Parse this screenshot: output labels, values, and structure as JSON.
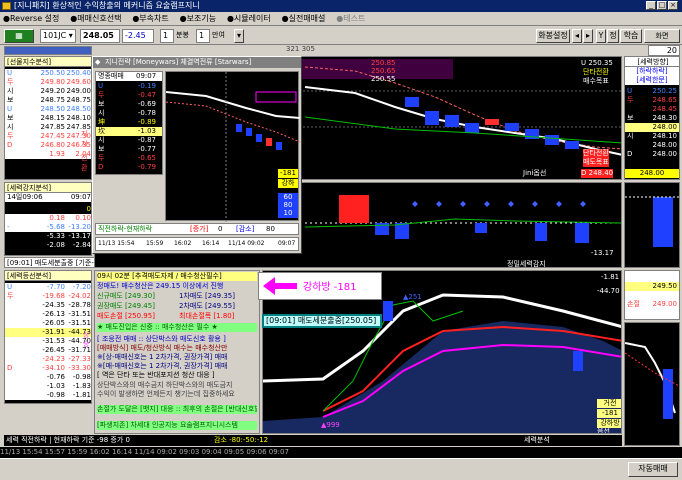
{
  "window": {
    "title": "[지니패치] 환상적인 수익창출의 메커니즘 요술램프지니"
  },
  "menu": [
    "Reverse 설정",
    "매매신호선택",
    "부속차트",
    "보조기능",
    "시뮬레이터",
    "실전매매설",
    "테스트"
  ],
  "toolbar": {
    "code": "101JC",
    "price": "248.05",
    "change": "-2.45",
    "interval": "1",
    "interval_unit": "분봉",
    "count": "1",
    "count_unit": "만여",
    "screen_settings": "화봉설정",
    "nav": [
      "Y",
      "정",
      "학습",
      "화면"
    ],
    "zoom_label": "화면",
    "zoom_value": "20",
    "scroll_label": "321 305"
  },
  "left_top": {
    "title": "[선물지수분석]",
    "rows": [
      {
        "k": "U",
        "a": "250.50",
        "b": "250.40",
        "cls": "wbox blu"
      },
      {
        "k": "두",
        "a": "249.80",
        "b": "249.60",
        "cls": "wbox red"
      },
      {
        "k": "시",
        "a": "249.20",
        "b": "249.00",
        "cls": "wbox"
      },
      {
        "k": "보",
        "a": "248.75",
        "b": "248.75",
        "cls": "wbox"
      },
      {
        "k": "U",
        "a": "248.50",
        "b": "248.50",
        "cls": "wbox blu"
      },
      {
        "k": "보",
        "a": "248.15",
        "b": "248.10",
        "cls": "wbox"
      },
      {
        "k": "시",
        "a": "247.85",
        "b": "247.85",
        "cls": "wbox"
      },
      {
        "k": "두",
        "a": "247.45",
        "b": "247.30",
        "cls": "wbox red"
      },
      {
        "k": "D",
        "a": "246.80",
        "b": "246.35",
        "cls": "wbox red"
      },
      {
        "k": "",
        "a": "1.93",
        "b": "2.04",
        "cls": "wbox red"
      }
    ],
    "side": [
      "지지",
      "전환"
    ]
  },
  "left_mid": {
    "title": "[세력강지분석]",
    "date": "14일09:06",
    "time": "09:07",
    "rows": [
      {
        "k": "",
        "a": "",
        "b": "0",
        "cls": "yel"
      },
      {
        "k": "",
        "a": "0.18",
        "b": "0.10",
        "cls": "wbox red"
      },
      {
        "k": "- ",
        "a": "-5.68",
        "b": "-13.20",
        "cls": "wbox blu"
      },
      {
        "k": "",
        "a": "-5.33",
        "b": "-13.17",
        "cls": "wht"
      },
      {
        "k": "",
        "a": "-2.08",
        "b": "-2.84",
        "cls": "wht"
      }
    ],
    "footer": "[09:01] 매도세분출중 [기준-22:25005][현재-98:24855]"
  },
  "left_bot": {
    "title": "[세력등선분석]",
    "rows": [
      {
        "k": "U",
        "a": "-7.70",
        "b": "-7.20",
        "cls": "wbox blu"
      },
      {
        "k": "두",
        "a": "-19.68",
        "b": "-24.02",
        "cls": "wbox red"
      },
      {
        "k": "",
        "a": "-24.35",
        "b": "-28.78",
        "cls": "wbox"
      },
      {
        "k": "",
        "a": "-26.13",
        "b": "-31.51",
        "cls": "wbox"
      },
      {
        "k": "",
        "a": "-26.05",
        "b": "-31.51",
        "cls": "wbox"
      },
      {
        "k": "",
        "a": "-31.91",
        "b": "-44.73",
        "cls": "hl"
      },
      {
        "k": "",
        "a": "-31.53",
        "b": "-44.70",
        "cls": "wbox"
      },
      {
        "k": "",
        "a": "-26.45",
        "b": "-31.71",
        "cls": "wbox"
      },
      {
        "k": "",
        "a": "-24.23",
        "b": "-27.33",
        "cls": "wbox red"
      },
      {
        "k": "D",
        "a": "-34.10",
        "b": "-33.30",
        "cls": "wbox red"
      },
      {
        "k": "",
        "a": "-0.76",
        "b": "-0.98",
        "cls": "wbox"
      },
      {
        "k": "",
        "a": "-1.03",
        "b": "-1.83",
        "cls": "wbox"
      },
      {
        "k": "",
        "a": "-0.98",
        "b": "-1.81",
        "cls": "wbox"
      }
    ],
    "side": "상승"
  },
  "popup": {
    "title": "지니전략 [Moneywars] 체결역전류 [Starwars]",
    "header_label": "명종매매",
    "header_time": "09:07",
    "rows": [
      {
        "k": "U",
        "a": "-0.19",
        "b": "-0.22",
        "cls": "blu"
      },
      {
        "k": "두",
        "a": "-0.47",
        "b": "-0.70",
        "cls": "red"
      },
      {
        "k": "보",
        "a": "-0.69",
        "b": "-0.87",
        "cls": "wht"
      },
      {
        "k": "시",
        "a": "-0.78",
        "b": "-0.97",
        "cls": "wht"
      },
      {
        "k": "坤",
        "a": "-0.89",
        "b": "-1.02",
        "cls": "yel"
      },
      {
        "k": "坎",
        "a": "-1.03",
        "b": "-1.03",
        "cls": "hl"
      },
      {
        "k": "시",
        "a": "-0.87",
        "b": "-0.92",
        "cls": "wht"
      },
      {
        "k": "보",
        "a": "-0.77",
        "b": "-1.01",
        "cls": "wht"
      },
      {
        "k": "두",
        "a": "-0.65",
        "b": "-0.84",
        "cls": "red"
      },
      {
        "k": "D",
        "a": "-0.79",
        "b": "-0.92",
        "cls": "red"
      }
    ],
    "right_tags": [
      "-181",
      "강하",
      "60",
      "80",
      "10"
    ],
    "footer_left": "직전하락-현재하락",
    "footer_inc_label": "[증가]",
    "footer_inc": "0",
    "footer_dec_label": "[감소]",
    "footer_dec": "80",
    "axis": [
      "11/13 15:54",
      "15:59",
      "16:02",
      "16:14",
      "11/14 09:02",
      "09:07"
    ]
  },
  "chart_top": {
    "labels": {
      "u": "U 250.35",
      "t1": "단타전환",
      "t2": "매수목표",
      "t3": "250.85",
      "t4": "250.65",
      "t5": "250.55",
      "d1": "단타전환",
      "d2": "매도목표",
      "d3": "Jini옵선",
      "d4": "D 248.40"
    }
  },
  "chart_mid": {
    "label_right": "-13.17",
    "label_bottom": "정밀세력감지"
  },
  "info_box": {
    "line1": "09시 02분 [추격매도자제 / 매수청산필수]",
    "line2": "정매도! 매수청산은 249.15 이상에서 진행",
    "rows": [
      {
        "a": "신규매도 [249.30]",
        "b": "1차매도 [249.35]"
      },
      {
        "a": "권장매도 [249.45]",
        "b": "2차매도 [249.55]"
      },
      {
        "a": "매도손절 [250.95]",
        "b": "최대손절폭 [1.80]"
      }
    ],
    "line3": "★ 매도진입은 신중 :: 매수청산은 필수 ★",
    "line4": "[ 조응전 매매 :: 상단박스와 매도신호 활용 ]",
    "line5": "[매매방식] 매도/청산방식 매수는 매수청산만",
    "line6": "※[상-매매신호는 1 2차가격, 권장가격] 매매",
    "line7": "※[매-매매신호는 1 2차가격, 권장가격] 매매",
    "line8": "[ 역은 단타 또는 반대포지션 청산 대응 ]",
    "line9": "상단박스와의 매수금지  하단박스와의 매도금지",
    "line10": "수익이 발생하면 언제든지 챙기는데 집중하세요",
    "stop": "손절가 도달은 [뱃지] 대응 :: 최후의 손절은 [반대신호발생]",
    "company": "[파생지존] 차세대 인공지능 요술램프지니시스템",
    "arrow_label": "강하방 -181",
    "signal": "[09:01] 매도세분출중[250.05]"
  },
  "chart_bot": {
    "pt": "▲251",
    "pt2": "▲999",
    "right1": "-1.81",
    "right2": "-44.70",
    "r_label1": "거전",
    "r_label2": "-181",
    "r_label3": "강하방",
    "r_label4": "음선"
  },
  "bottom_bar": {
    "left": "세력 직전하락 | 현재하락 기준 -98 증가 0",
    "mid": "감소 -80:-50:-12",
    "right": "세력분석"
  },
  "right_panel": {
    "title": "[세력방향]",
    "sub": "[하락하락]",
    "sub2": "[세력한문]",
    "rows": [
      {
        "k": "U",
        "v": "250.25",
        "cls": "blu"
      },
      {
        "k": "두",
        "v": "248.65",
        "cls": "red"
      },
      {
        "k": "",
        "v": "248.45",
        "cls": "red"
      },
      {
        "k": "보",
        "v": "248.30",
        "cls": "wht"
      },
      {
        "k": "",
        "v": "248.00",
        "cls": "hl"
      },
      {
        "k": "시",
        "v": "248.10",
        "cls": "wht"
      },
      {
        "k": "",
        "v": "248.00",
        "cls": "wht"
      },
      {
        "k": "D",
        "v": "248.00",
        "cls": "wht"
      }
    ],
    "mid_label": "248.00",
    "grid": [
      {
        "k": "상단",
        "v": "249.15",
        "cls": "wht"
      },
      {
        "k": "",
        "v": "249.50",
        "cls": "hl"
      },
      {
        "k": "기준",
        "v": "248.50",
        "cls": "wht"
      },
      {
        "k": "손절",
        "v": "249.00",
        "cls": "red"
      },
      {
        "k": "물공",
        "v": "249.50",
        "cls": "wht"
      }
    ],
    "auto": "자동매매"
  },
  "status": "11/13 15:54  15:57  15:59  16:02  16:14  11/14 09:02  09:03  09:04  09:05  09:06  09:07",
  "colors": {
    "red": "#ff3030",
    "blue": "#2040ff",
    "green": "#00c000",
    "magenta": "#ff00ff",
    "yellow": "#ffff00"
  }
}
